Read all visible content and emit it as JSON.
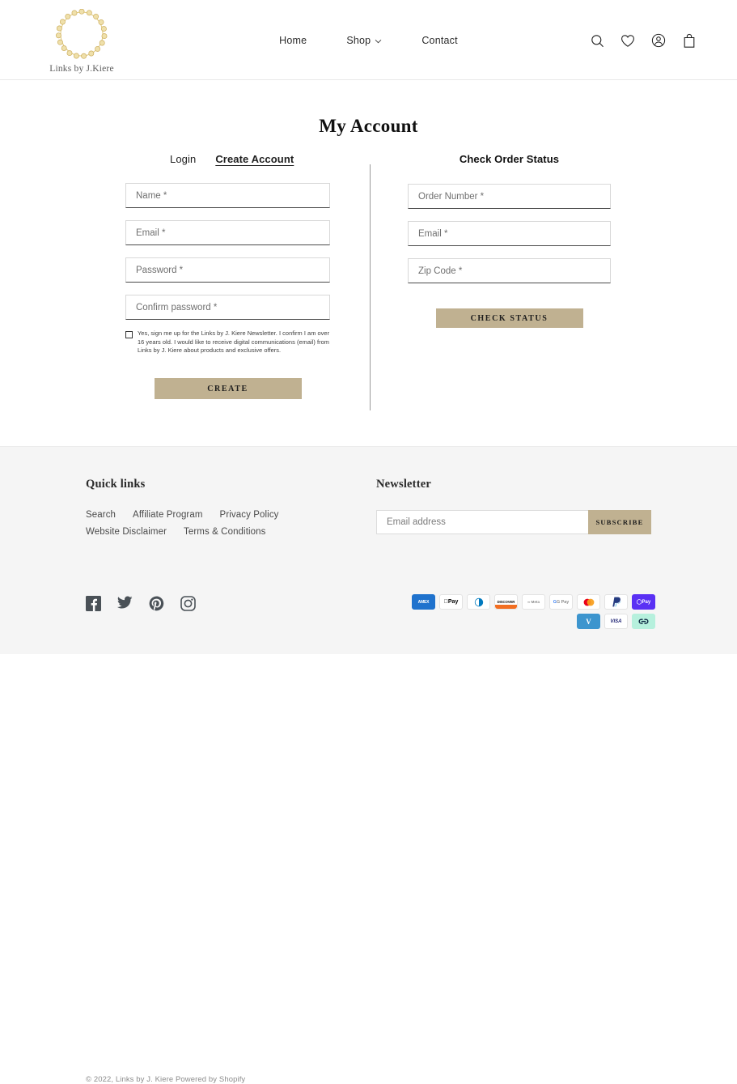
{
  "header": {
    "logo": {
      "brand": "Links by J.Kiere",
      "icon": "chain-ring-logo"
    },
    "nav": [
      {
        "label": "Home",
        "has_dropdown": false
      },
      {
        "label": "Shop",
        "has_dropdown": true
      },
      {
        "label": "Contact",
        "has_dropdown": false
      }
    ],
    "icons": [
      {
        "name": "search-icon"
      },
      {
        "name": "heart-icon"
      },
      {
        "name": "account-icon"
      },
      {
        "name": "bag-icon"
      }
    ]
  },
  "main": {
    "title": "My Account",
    "tabs": [
      {
        "label": "Login",
        "active": false
      },
      {
        "label": "Create Account",
        "active": true
      }
    ],
    "create_account": {
      "fields": [
        {
          "name": "name",
          "placeholder": "Name *",
          "value": ""
        },
        {
          "name": "email",
          "placeholder": "Email *",
          "value": ""
        },
        {
          "name": "password",
          "placeholder": "Password *",
          "value": ""
        },
        {
          "name": "confirm_password",
          "placeholder": "Confirm password *",
          "value": ""
        }
      ],
      "newsletter_consent": {
        "checked": false,
        "text": "Yes, sign me up for the Links by J. Kiere Newsletter. I confirm I am over 16 years old. I would like to receive digital communications (email) from Links by J. Kiere about products and exclusive offers."
      },
      "submit_label": "CREATE"
    },
    "order_status": {
      "heading": "Check Order Status",
      "fields": [
        {
          "name": "order_number",
          "placeholder": "Order Number *",
          "value": ""
        },
        {
          "name": "email",
          "placeholder": "Email *",
          "value": ""
        },
        {
          "name": "zip_code",
          "placeholder": "Zip Code *",
          "value": ""
        }
      ],
      "submit_label": "CHECK STATUS"
    }
  },
  "footer": {
    "quick_links": {
      "heading": "Quick links",
      "items": [
        "Search",
        "Affiliate Program",
        "Privacy Policy",
        "Website Disclaimer",
        "Terms & Conditions"
      ]
    },
    "newsletter": {
      "heading": "Newsletter",
      "placeholder": "Email address",
      "value": "",
      "button_label": "SUBSCRIBE"
    },
    "social": [
      {
        "name": "facebook-icon"
      },
      {
        "name": "twitter-icon"
      },
      {
        "name": "pinterest-icon"
      },
      {
        "name": "instagram-icon"
      }
    ],
    "payments": [
      {
        "name": "american-express",
        "label": "AMEX"
      },
      {
        "name": "apple-pay",
        "label": "Pay"
      },
      {
        "name": "diners-club",
        "label": "DC"
      },
      {
        "name": "discover",
        "label": "DISCOVER"
      },
      {
        "name": "meta-pay",
        "label": "Meta"
      },
      {
        "name": "google-pay",
        "label": "G Pay"
      },
      {
        "name": "mastercard",
        "label": "MC"
      },
      {
        "name": "paypal",
        "label": "P"
      },
      {
        "name": "shop-pay",
        "label": "Pay"
      },
      {
        "name": "venmo",
        "label": "V"
      },
      {
        "name": "visa",
        "label": "VISA"
      },
      {
        "name": "shopify-link",
        "label": "link"
      }
    ],
    "copyright": "© 2022, Links by J. Kiere Powered by Shopify"
  },
  "colors": {
    "accent_tan": "#c0b191",
    "footer_bg": "#f5f5f5",
    "text": "#1a1a1a"
  }
}
